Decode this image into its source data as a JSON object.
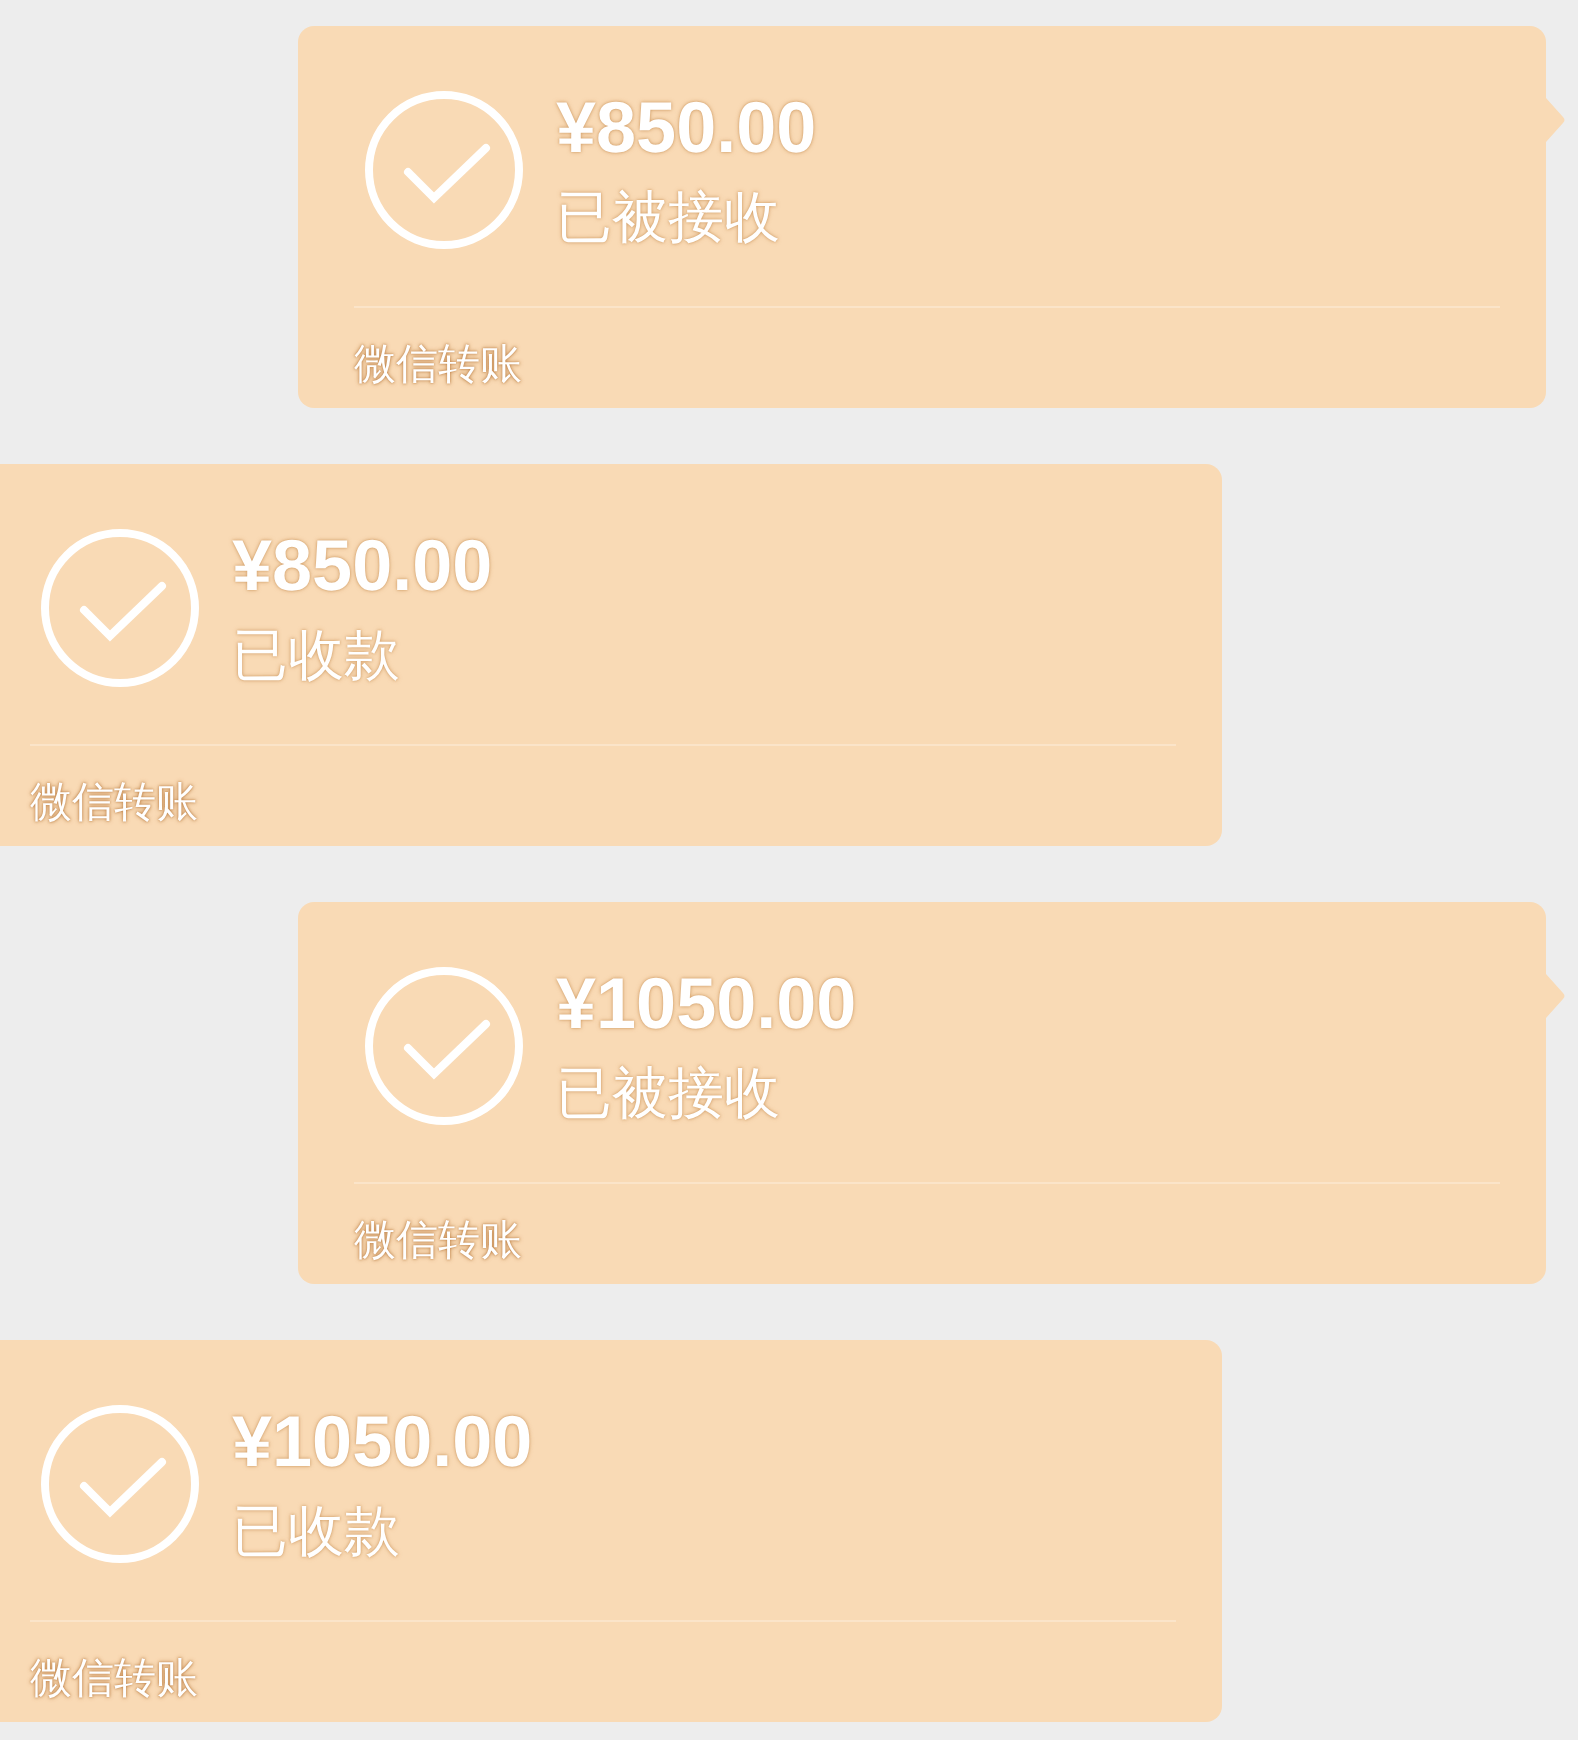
{
  "messages": [
    {
      "kind": "sent",
      "amount": "¥850.00",
      "status": "已被接收",
      "footer": "微信转账"
    },
    {
      "kind": "received",
      "amount": "¥850.00",
      "status": "已收款",
      "footer": "微信转账"
    },
    {
      "kind": "sent",
      "amount": "¥1050.00",
      "status": "已被接收",
      "footer": "微信转账"
    },
    {
      "kind": "received",
      "amount": "¥1050.00",
      "status": "已收款",
      "footer": "微信转账"
    }
  ]
}
